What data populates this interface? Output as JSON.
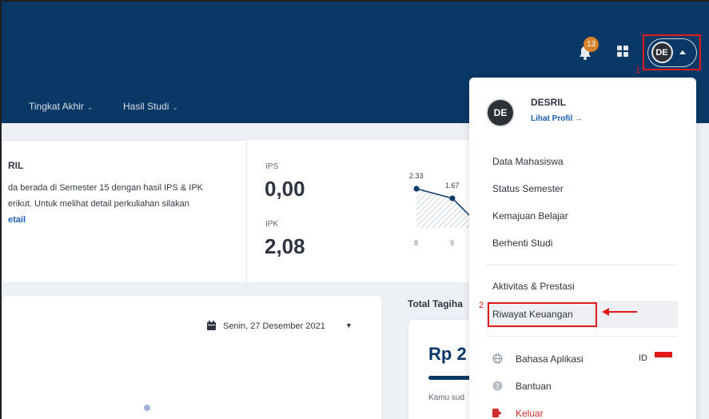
{
  "header": {
    "notification_count": "13",
    "user_initials": "DE",
    "nav": [
      {
        "label": "Tingkat Akhir"
      },
      {
        "label": "Hasil Studi"
      }
    ]
  },
  "annotations": {
    "one": "1",
    "two": "2"
  },
  "welcome": {
    "title": "RIL",
    "line1": "da berada di Semester 15 dengan hasil IPS & IPK",
    "line2": "erikut. Untuk melihat detail perkuliahan silakan",
    "link": "etail"
  },
  "stats": {
    "ips_label": "IPS",
    "ips_value": "0,00",
    "ipk_label": "IPK",
    "ipk_value": "2,08",
    "chart_values": [
      "2.33",
      "1.67"
    ],
    "chart_ticks": [
      "8",
      "9"
    ]
  },
  "schedule": {
    "date": "Senin, 27 Desember 2021"
  },
  "billing": {
    "title": "Total Tagiha",
    "amount": "Rp 2",
    "note": "Kamu sud"
  },
  "menu": {
    "avatar": "DE",
    "name": "DESRIL",
    "profile_link": "Lihat Profil →",
    "group1": [
      "Data Mahasiswa",
      "Status Semester",
      "Kemajuan Belajar",
      "Berhenti Studi"
    ],
    "group2": [
      "Aktivitas & Prestasi",
      "Riwayat Keuangan"
    ],
    "language_label": "Bahasa Aplikasi",
    "language_value": "ID",
    "help": "Bantuan",
    "logout": "Keluar"
  },
  "colors": {
    "header": "#0a3866",
    "accent": "#1f5fb4",
    "annotation": "#e01b1b",
    "logout": "#d32f2f"
  }
}
